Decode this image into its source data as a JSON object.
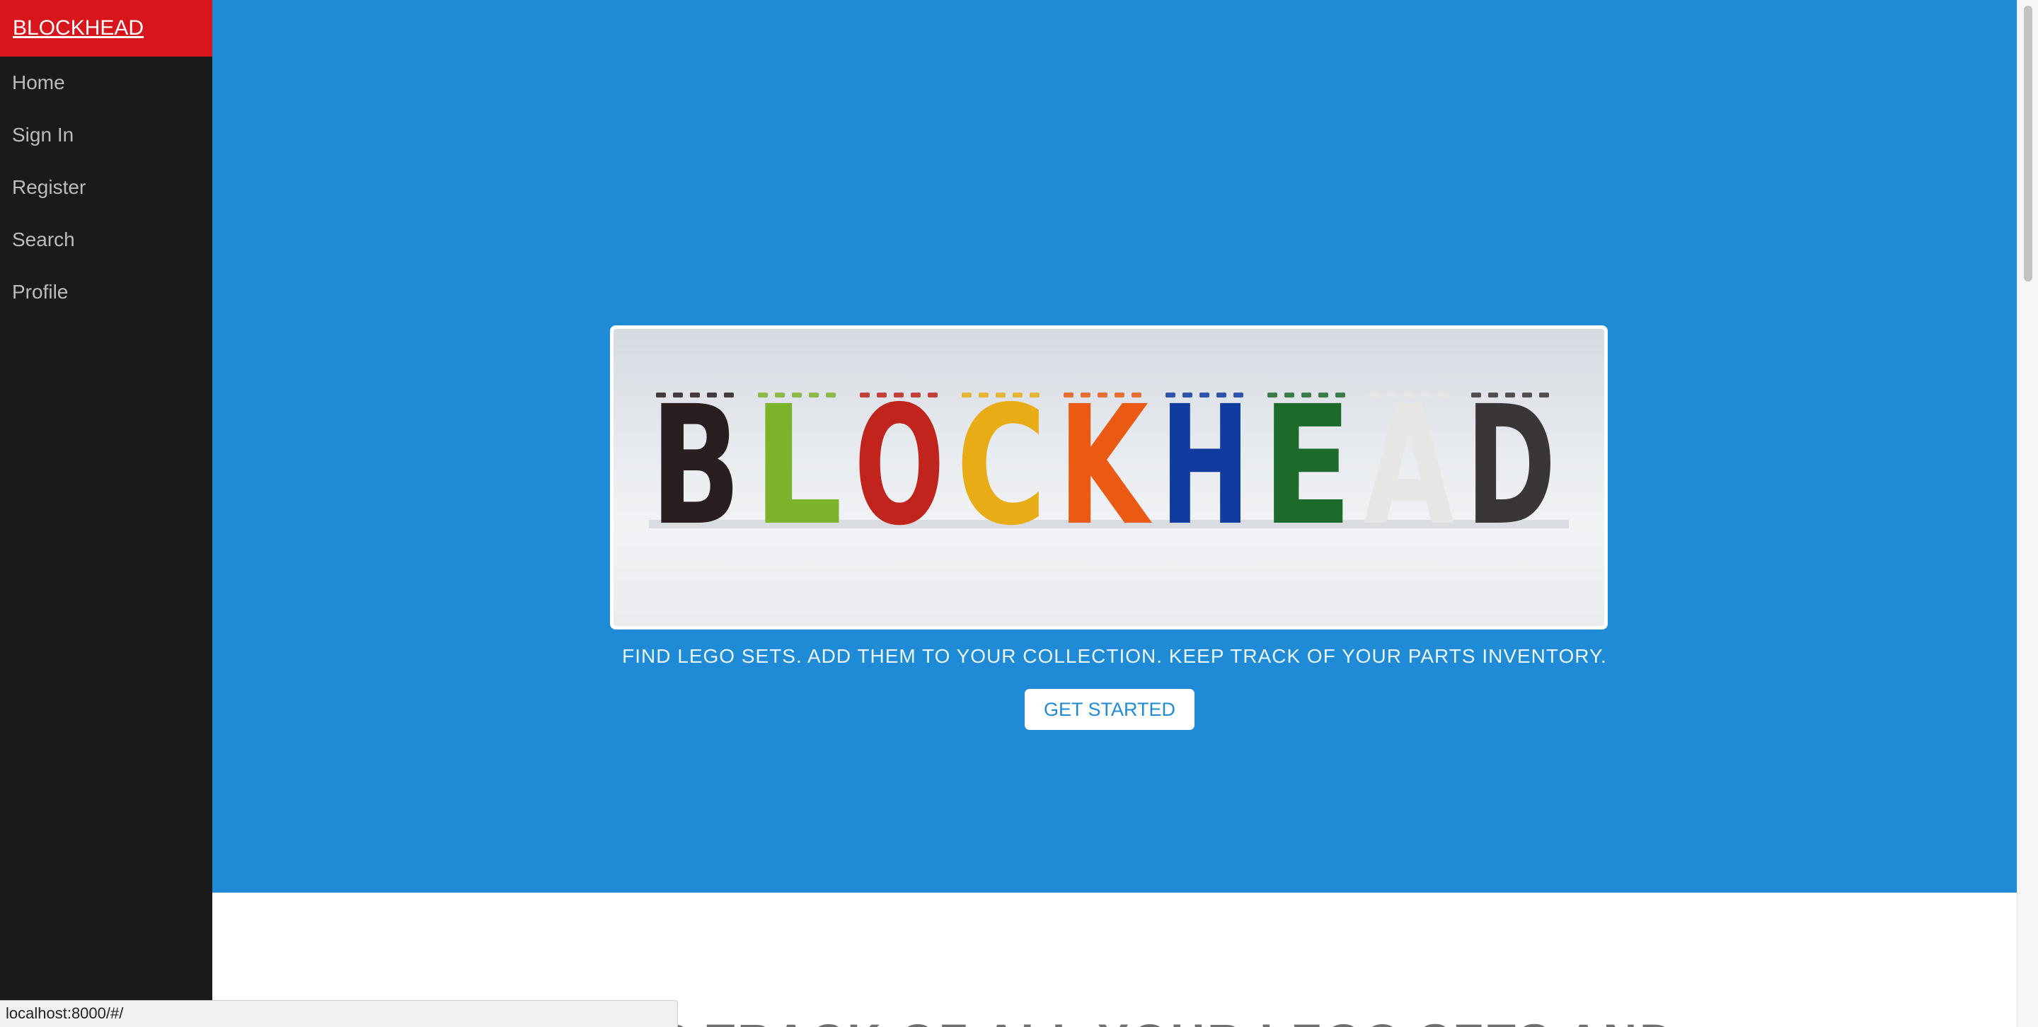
{
  "sidebar": {
    "brand": "BLOCKHEAD",
    "items": [
      {
        "label": "Home",
        "name": "sidebar-item-home"
      },
      {
        "label": "Sign In",
        "name": "sidebar-item-sign-in"
      },
      {
        "label": "Register",
        "name": "sidebar-item-register"
      },
      {
        "label": "Search",
        "name": "sidebar-item-search"
      },
      {
        "label": "Profile",
        "name": "sidebar-item-profile"
      }
    ]
  },
  "hero": {
    "banner_word": "BLOCKHEAD",
    "tagline": "FIND LEGO SETS. ADD THEM TO YOUR COLLECTION. KEEP TRACK OF YOUR PARTS INVENTORY.",
    "cta_label": "GET STARTED"
  },
  "section": {
    "heading": "KEEP TRACK OF ALL YOUR LEGO SETS AND"
  },
  "status_bar": {
    "url": "localhost:8000/#/"
  },
  "colors": {
    "sidebar_bg": "#1a1a1a",
    "brand_bg": "#d7151b",
    "hero_bg": "#1f8bd6",
    "letter_colors": [
      "#2a1d1f",
      "#7db32a",
      "#c0241c",
      "#e8ac16",
      "#ea5a12",
      "#0f3c9e",
      "#1d6b2b",
      "#e6e6e4",
      "#3a3538"
    ]
  }
}
